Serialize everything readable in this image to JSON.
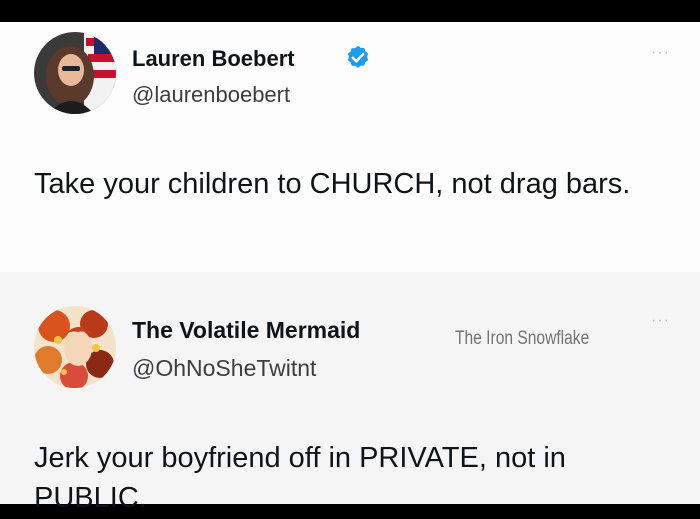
{
  "tweets": [
    {
      "display_name": "Lauren Boebert",
      "handle": "@laurenboebert",
      "verified": true,
      "text": "Take your children to CHURCH, not drag bars.",
      "avatar_icon": "profile-photo-woman-flag"
    },
    {
      "display_name": "The Volatile Mermaid",
      "handle": "@OhNoSheTwitnt",
      "text": "Jerk your boyfriend off in PRIVATE, not in PUBLIC.",
      "avatar_icon": "profile-illustration-colorful"
    }
  ],
  "more_label": "···",
  "watermark": "The Iron Snowflake",
  "colors": {
    "verified_blue": "#1d9bf0",
    "text": "#0f1419",
    "handle": "#3a3f44"
  }
}
